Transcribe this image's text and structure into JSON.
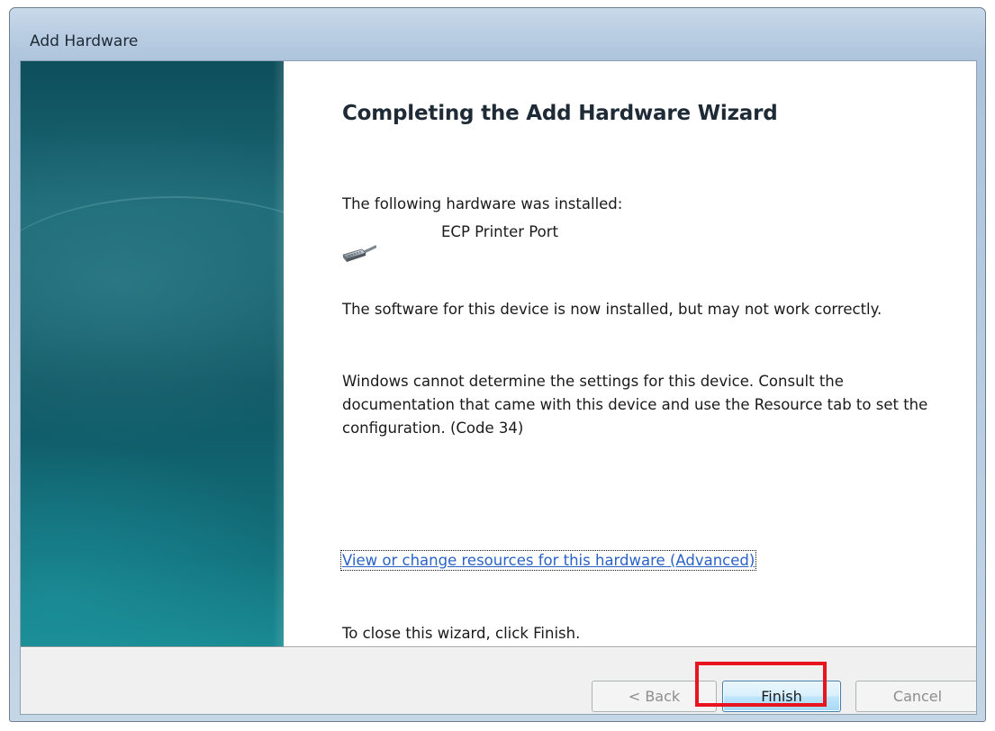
{
  "window": {
    "title": "Add Hardware"
  },
  "wizard": {
    "heading": "Completing the Add Hardware Wizard",
    "installed_label": "The following hardware was installed:",
    "device_name": "ECP Printer Port",
    "device_icon": "parallel-port-icon",
    "warning_text": "The software for this device is now installed, but may not work correctly.",
    "code_text": "Windows cannot determine the settings for this device. Consult the documentation that came with this device and use the Resource tab to set the configuration. (Code 34)",
    "resources_link": "View or change resources for this hardware (Advanced)",
    "close_hint": "To close this wizard, click Finish."
  },
  "buttons": {
    "back_label": "< Back",
    "finish_label": "Finish",
    "cancel_label": "Cancel"
  },
  "colors": {
    "highlight": "#e8141f",
    "link": "#2a63c5",
    "side_panel": "#0f5663"
  }
}
